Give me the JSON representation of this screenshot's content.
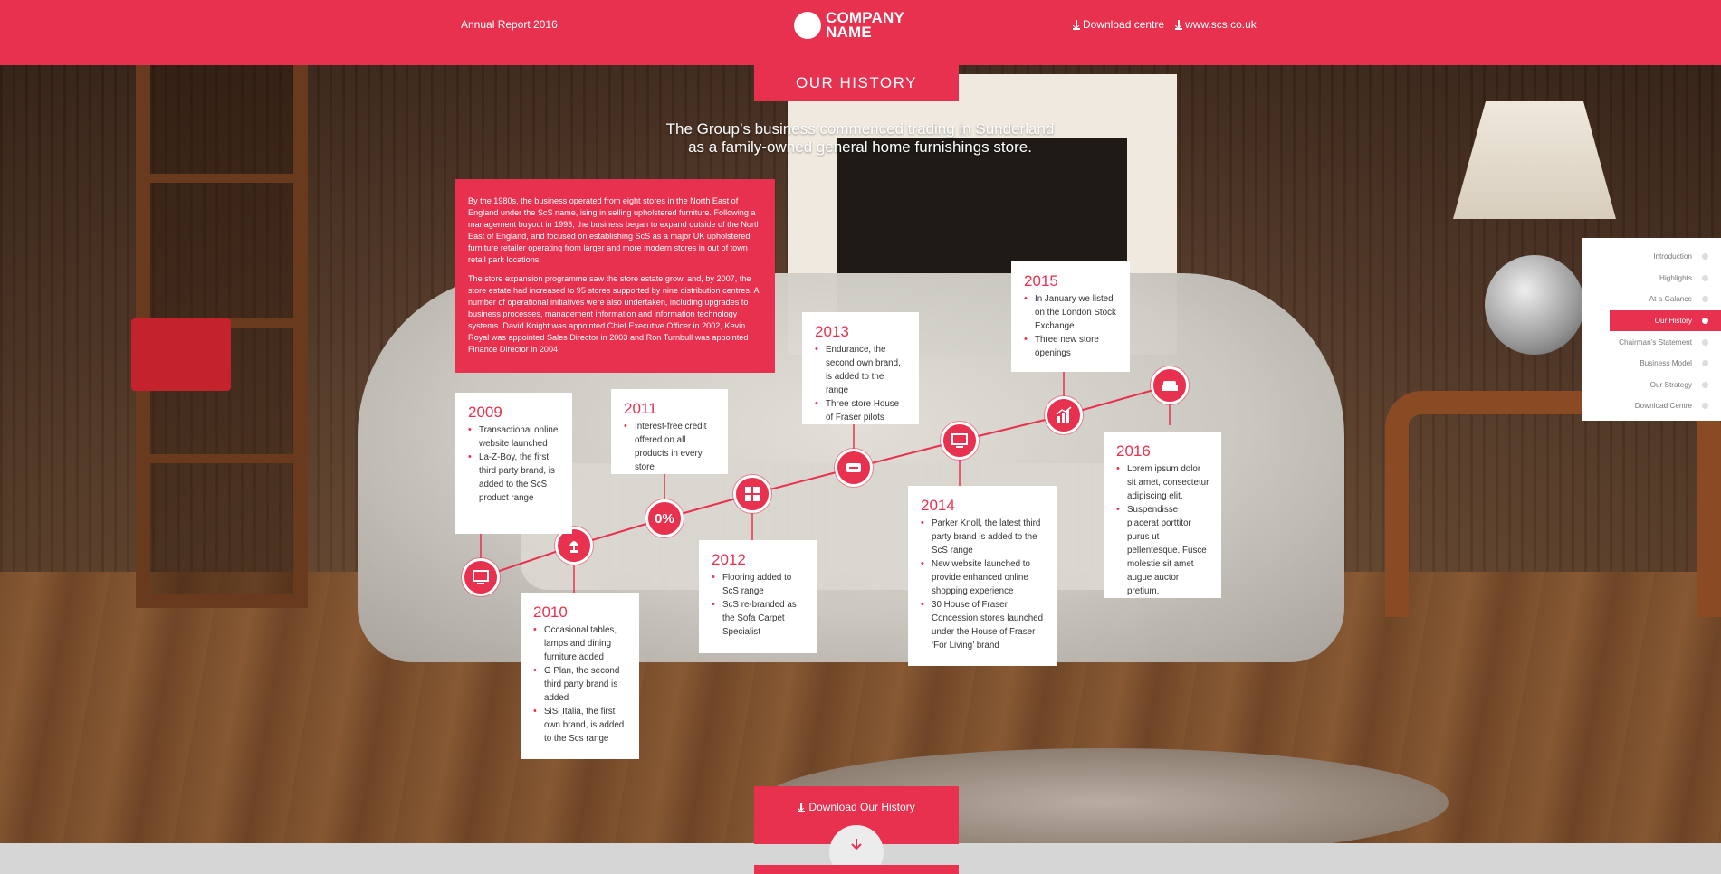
{
  "header": {
    "report_title": "Annual Report 2016",
    "logo_text": "COMPANY NAME",
    "logo_line1": "COMPANY",
    "logo_line2": "NAME",
    "download_centre": "Download centre",
    "website": "www.scs.co.uk"
  },
  "section": {
    "tab_title": "OUR HISTORY",
    "intro_line1": "The Group’s business commenced trading in Sunderland",
    "intro_line2": "as a family-owned general home furnishings store."
  },
  "summary": {
    "p1": "By the 1980s, the business operated from eight stores in the North East of England under the ScS name, ising in selling upholstered furniture. Following a management buyout in 1993, the business began to expand outside of the North East of England, and focused on establishing ScS as a major UK upholstered furniture retailer operating from larger and more modern stores in out of town retail park locations.",
    "p2": "The store expansion programme saw the store estate grow, and, by 2007, the store estate had increased to 95 stores supported by nine distribution centres. A number of operational initiatives were also undertaken, including upgrades to business processes, management information and information technology systems. David Knight was appointed Chief Executive Officer in 2002, Kevin Royal was appointed Sales Director in 2003 and Ron Turnbull was appointed Finance Director in 2004."
  },
  "timeline": [
    {
      "year": "2009",
      "icon": "monitor-icon",
      "items": [
        "Transactional online website launched",
        "La-Z-Boy, the first third party brand, is added to the ScS product range"
      ]
    },
    {
      "year": "2010",
      "icon": "lamp-icon",
      "items": [
        "Occasional tables, lamps and dining furniture added",
        "G Plan, the second third party brand is added",
        "SiSi Italia, the first own brand, is added to the Scs range"
      ]
    },
    {
      "year": "2011",
      "icon": "percent-icon",
      "icon_text": "0%",
      "items": [
        "Interest-free credit offered on all products in every store"
      ]
    },
    {
      "year": "2012",
      "icon": "grid-icon",
      "items": [
        "Flooring added to ScS range",
        "ScS re-branded as the Sofa Carpet Specialist"
      ]
    },
    {
      "year": "2013",
      "icon": "sofa-icon",
      "items": [
        "Endurance, the second own brand, is added to the range",
        "Three store House of Fraser pilots"
      ]
    },
    {
      "year": "2014",
      "icon": "monitor-icon",
      "items": [
        "Parker Knoll, the latest third party brand is added to the ScS range",
        "New website launched to provide enhanced online shopping experience",
        "30 House of Fraser Concession stores launched under the House of Fraser ‘For Living’ brand"
      ]
    },
    {
      "year": "2015",
      "icon": "bar-chart-icon",
      "items": [
        "In January we listed on the London Stock Exchange",
        "Three new store openings"
      ]
    },
    {
      "year": "2016",
      "icon": "armchair-icon",
      "items": [
        "Lorem ipsum dolor sit amet, consectetur adipiscing elit.",
        "Suspendisse placerat porttitor purus ut pellentesque. Fusce molestie sit amet augue auctor pretium."
      ]
    }
  ],
  "side_nav": [
    {
      "label": "Introduction",
      "active": false
    },
    {
      "label": "Highlights",
      "active": false
    },
    {
      "label": "At a Galance",
      "active": false
    },
    {
      "label": "Our History",
      "active": true
    },
    {
      "label": "Chairman’s Statement",
      "active": false
    },
    {
      "label": "Business Model",
      "active": false
    },
    {
      "label": "Our Strategy",
      "active": false
    },
    {
      "label": "Download Centre",
      "active": false
    }
  ],
  "footer": {
    "download_history": "Download Our History",
    "scroll_icon": "arrow-down-icon"
  },
  "colors": {
    "accent": "#e8304f"
  }
}
